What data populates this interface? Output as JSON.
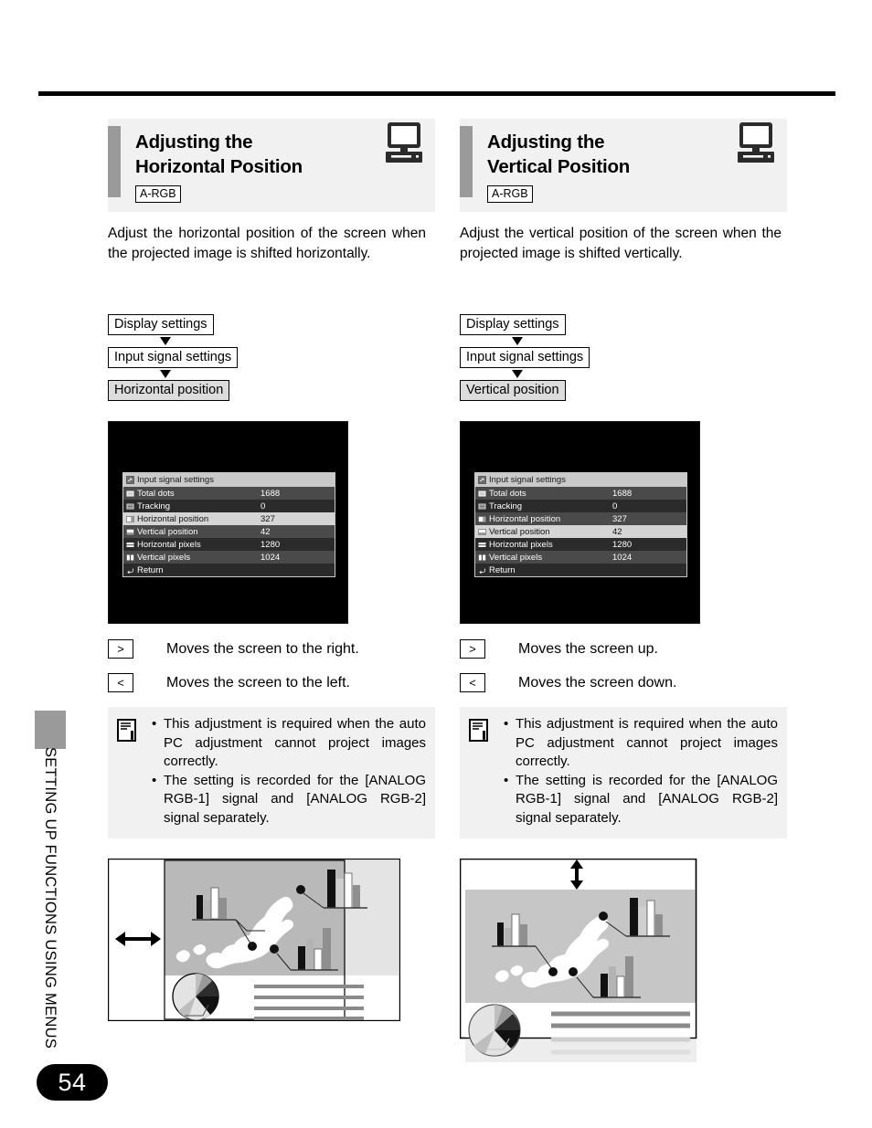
{
  "page": {
    "number": "54",
    "running_head": "SETTING UP FUNCTIONS USING MENUS"
  },
  "columns": [
    {
      "id": "horizontal",
      "header": {
        "title_line1": "Adjusting the",
        "title_line2": "Horizontal Position",
        "tag": "A-RGB",
        "icon": "computer-monitor-icon"
      },
      "description": "Adjust the horizontal position of the screen when the projected image is shifted horizontally.",
      "flow": [
        {
          "label": "Display settings",
          "current": false
        },
        {
          "label": "Input signal settings",
          "current": false
        },
        {
          "label": "Horizontal position",
          "current": true
        }
      ],
      "osd": {
        "title": "Input signal settings",
        "title_icon": "menu-icon",
        "rows": [
          {
            "icon": "total-dots-icon",
            "label": "Total dots",
            "value": "1688",
            "selected": false
          },
          {
            "icon": "tracking-icon",
            "label": "Tracking",
            "value": "0",
            "selected": false
          },
          {
            "icon": "horizontal-position-icon",
            "label": "Horizontal position",
            "value": "327",
            "selected": true
          },
          {
            "icon": "vertical-position-icon",
            "label": "Vertical position",
            "value": "42",
            "selected": false
          },
          {
            "icon": "horizontal-pixels-icon",
            "label": "Horizontal pixels",
            "value": "1280",
            "selected": false
          },
          {
            "icon": "vertical-pixels-icon",
            "label": "Vertical pixels",
            "value": "1024",
            "selected": false
          }
        ],
        "footer": {
          "icon": "return-arrow-icon",
          "label": "Return"
        }
      },
      "keys": [
        {
          "key": ">",
          "text": "Moves the screen to the right."
        },
        {
          "key": "<",
          "text": "Moves the screen to the left."
        }
      ],
      "note": {
        "icon": "note-memo-icon",
        "bullets": [
          "This adjustment is required when the auto PC adjustment cannot project images correctly.",
          "The setting is recorded for the [ANALOG RGB-1] signal and [ANALOG RGB-2] signal separately."
        ]
      },
      "illustration": {
        "arrow": "horizontal-double-arrow",
        "caption": ""
      }
    },
    {
      "id": "vertical",
      "header": {
        "title_line1": "Adjusting the",
        "title_line2": "Vertical Position",
        "tag": "A-RGB",
        "icon": "computer-monitor-icon"
      },
      "description": "Adjust the vertical position of the screen when the projected image is shifted vertically.",
      "flow": [
        {
          "label": "Display settings",
          "current": false
        },
        {
          "label": "Input signal settings",
          "current": false
        },
        {
          "label": "Vertical position",
          "current": true
        }
      ],
      "osd": {
        "title": "Input signal settings",
        "title_icon": "menu-icon",
        "rows": [
          {
            "icon": "total-dots-icon",
            "label": "Total dots",
            "value": "1688",
            "selected": false
          },
          {
            "icon": "tracking-icon",
            "label": "Tracking",
            "value": "0",
            "selected": false
          },
          {
            "icon": "horizontal-position-icon",
            "label": "Horizontal position",
            "value": "327",
            "selected": false
          },
          {
            "icon": "vertical-position-icon",
            "label": "Vertical position",
            "value": "42",
            "selected": true
          },
          {
            "icon": "horizontal-pixels-icon",
            "label": "Horizontal pixels",
            "value": "1280",
            "selected": false
          },
          {
            "icon": "vertical-pixels-icon",
            "label": "Vertical pixels",
            "value": "1024",
            "selected": false
          }
        ],
        "footer": {
          "icon": "return-arrow-icon",
          "label": "Return"
        }
      },
      "keys": [
        {
          "key": ">",
          "text": "Moves the screen up."
        },
        {
          "key": "<",
          "text": "Moves the screen down."
        }
      ],
      "note": {
        "icon": "note-memo-icon",
        "bullets": [
          "This adjustment is required when the auto PC adjustment cannot project images correctly.",
          "The setting is recorded for the [ANALOG RGB-1] signal and [ANALOG RGB-2] signal separately."
        ]
      },
      "illustration": {
        "arrow": "vertical-double-arrow",
        "caption": ""
      }
    }
  ],
  "colors": {
    "header_bg": "#f1f1f1",
    "accent_gray": "#9a9a9a",
    "flow_current_bg": "#dcdcdc",
    "osd_selected_bg": "#d4d4d4",
    "page_badge_bg": "#000000"
  }
}
